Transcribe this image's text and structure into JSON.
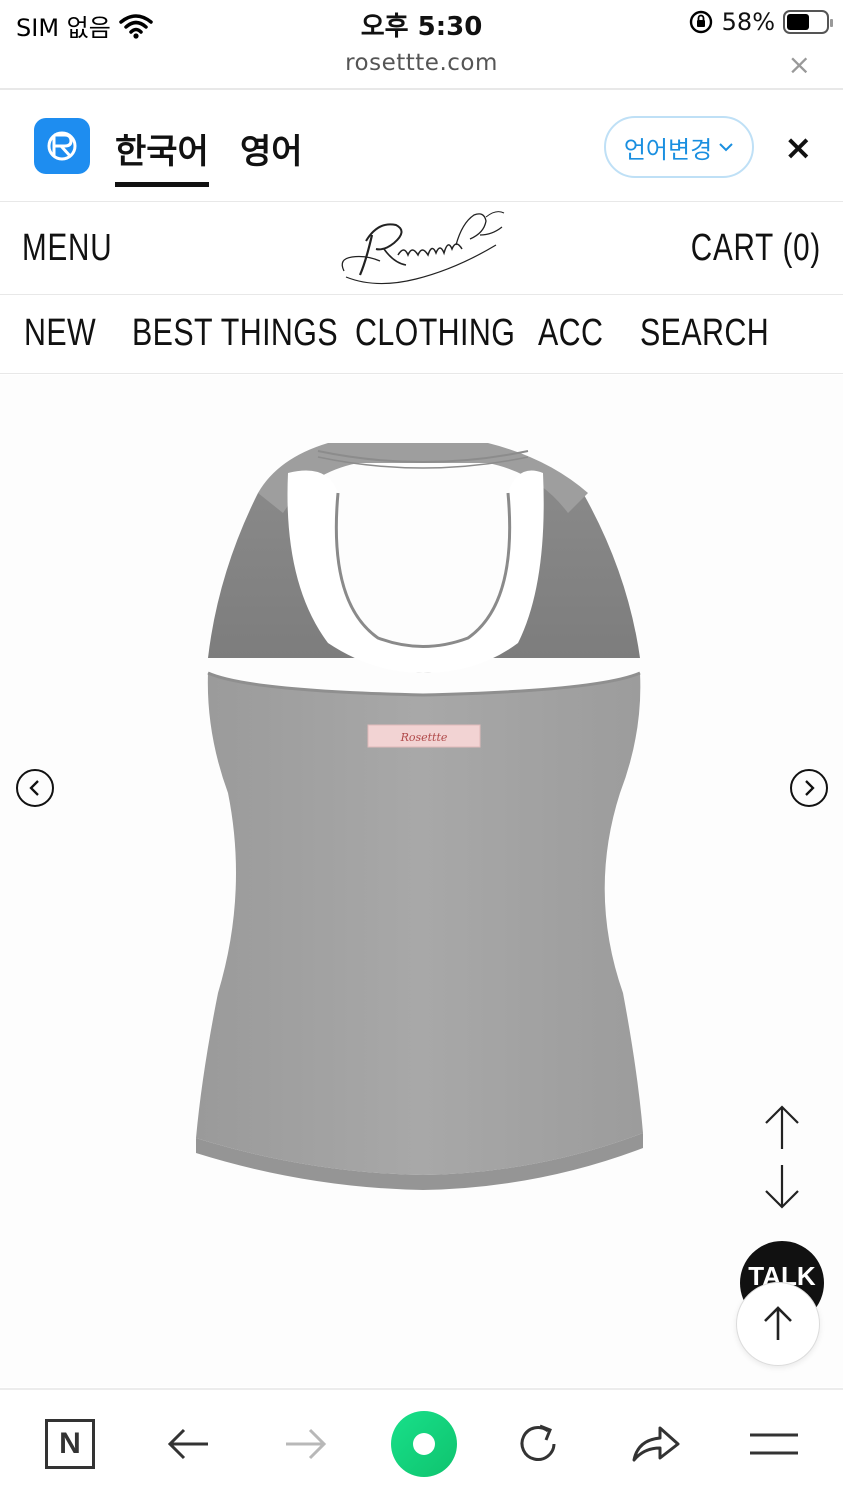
{
  "status_bar": {
    "carrier": "SIM 없음",
    "time": "오후 5:30",
    "battery": "58%"
  },
  "url_bar": {
    "url": "rosettte.com",
    "close": "×"
  },
  "translate_bar": {
    "tabs": [
      {
        "label": "한국어",
        "active": true
      },
      {
        "label": "영어",
        "active": false
      }
    ],
    "change_language": "언어변경",
    "close": "×"
  },
  "site_header": {
    "menu": "MENU",
    "logo_text": "Rosettte",
    "cart": "CART (0)"
  },
  "category_nav": [
    "NEW",
    "BEST THINGS",
    "CLOTHING",
    "ACC",
    "SEARCH"
  ],
  "product": {
    "label_text": "Rosettte"
  },
  "floating": {
    "talk": "TALK"
  },
  "icons": {
    "prev": "chevron-left-icon",
    "next": "chevron-right-icon",
    "up": "arrow-up-icon",
    "down": "arrow-down-icon",
    "top": "arrow-up-icon"
  },
  "toolbar": {
    "home_letter": "N",
    "items": [
      "naver-home-icon",
      "back-arrow-icon",
      "forward-arrow-icon",
      "green-dot-icon",
      "refresh-icon",
      "share-icon",
      "menu-icon"
    ]
  },
  "colors": {
    "accent_blue": "#1e8df0",
    "garment_gray": "#a3a3a3",
    "label_pink": "#f2d3d3",
    "green": "#14d27f"
  }
}
